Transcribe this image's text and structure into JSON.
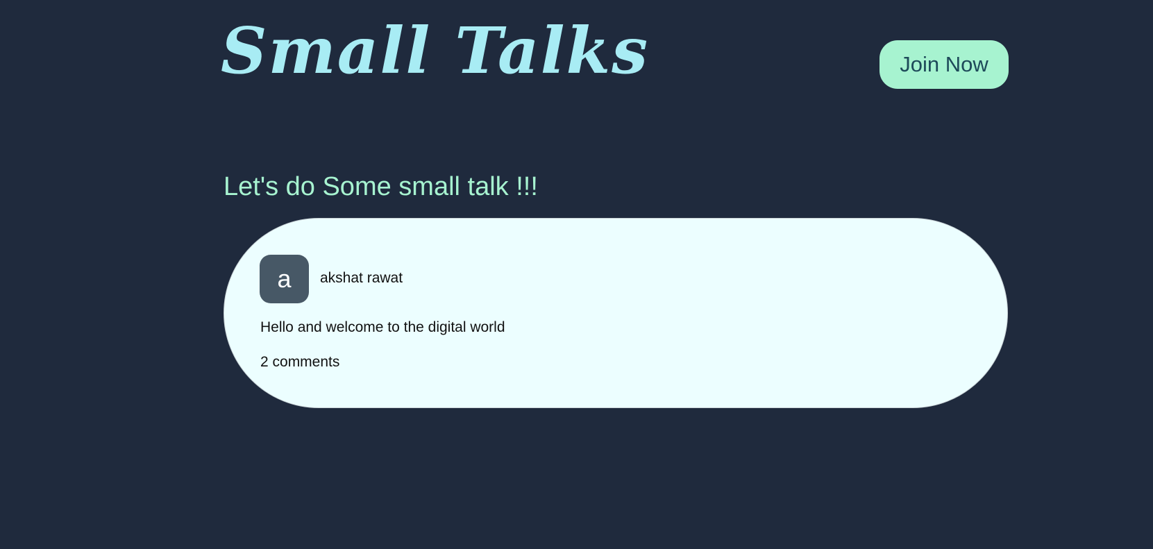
{
  "header": {
    "logo_text": "Small Talks",
    "join_label": "Join Now"
  },
  "main": {
    "heading": "Let's do Some small talk !!!",
    "posts": [
      {
        "avatar_letter": "a",
        "author": "akshat rawat",
        "text": "Hello and welcome to the digital world",
        "comments_label": "2 comments"
      }
    ]
  },
  "colors": {
    "background": "#1f2a3d",
    "logo": "#a8ecf4",
    "accent": "#a7f3d0",
    "card": "#ecfeff",
    "avatar": "#475866"
  }
}
